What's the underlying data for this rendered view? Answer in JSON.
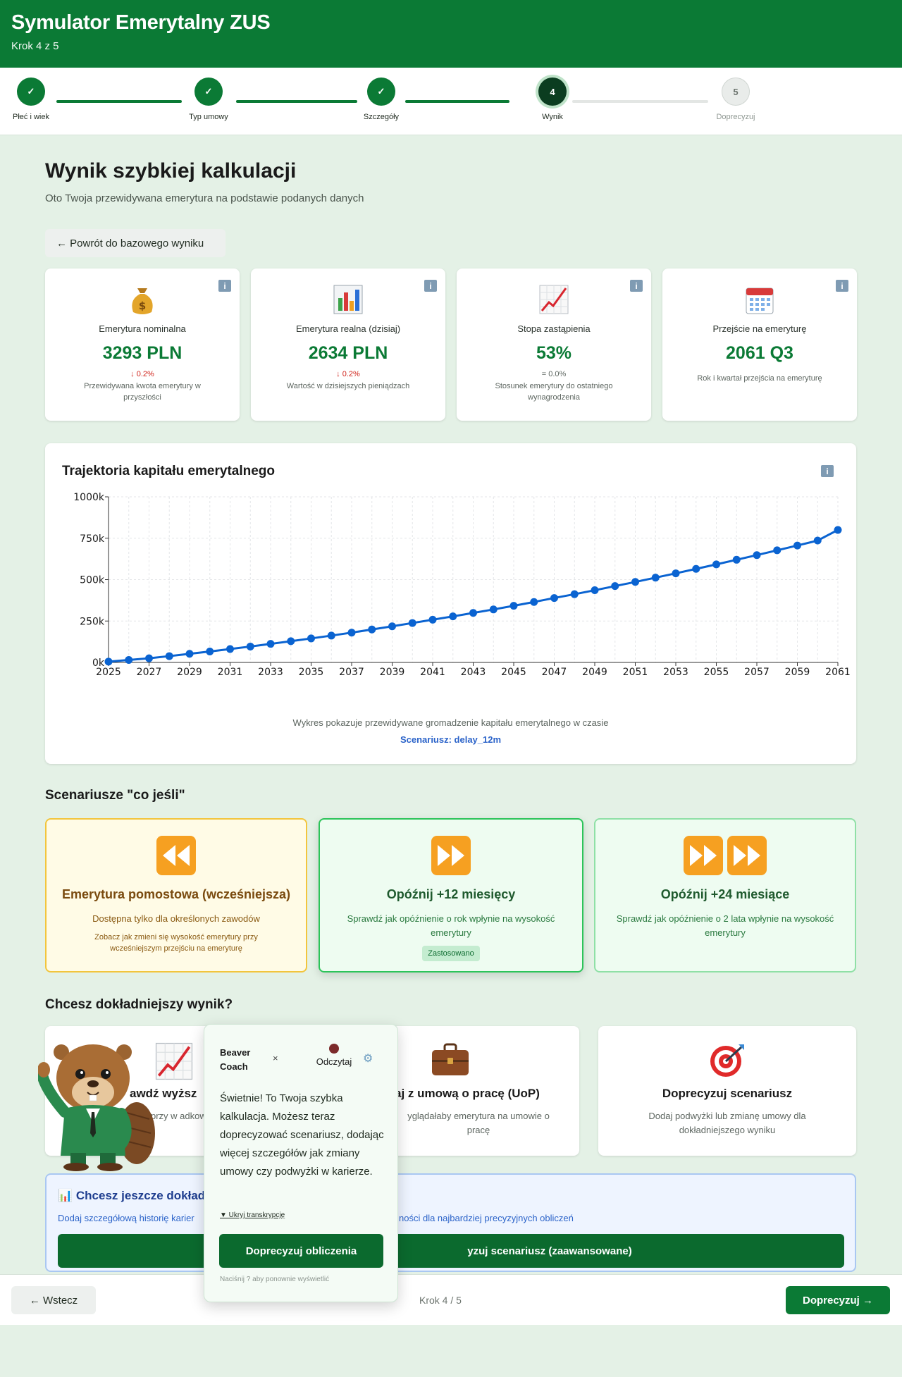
{
  "header": {
    "title": "Symulator Emerytalny ZUS",
    "step_text": "Krok 4 z 5"
  },
  "stepper": {
    "steps": [
      {
        "num": "✓",
        "label": "Płeć i wiek",
        "state": "done"
      },
      {
        "num": "✓",
        "label": "Typ umowy",
        "state": "done"
      },
      {
        "num": "✓",
        "label": "Szczegóły",
        "state": "done"
      },
      {
        "num": "4",
        "label": "Wynik",
        "state": "current"
      },
      {
        "num": "5",
        "label": "Doprecyzuj",
        "state": "todo"
      }
    ]
  },
  "main": {
    "title": "Wynik szybkiej kalkulacji",
    "subtitle": "Oto Twoja przewidywana emerytura na podstawie podanych danych",
    "back_button": "← Powrót do bazowego wyniku"
  },
  "metrics": [
    {
      "icon": "money-bag-icon",
      "label": "Emerytura nominalna",
      "value": "3293 PLN",
      "delta": "↓ 0.2%",
      "delta_color": "#d0241b",
      "desc": "Przewidywana kwota emerytury w przyszłości"
    },
    {
      "icon": "bar-chart-icon",
      "label": "Emerytura realna (dzisiaj)",
      "value": "2634 PLN",
      "delta": "↓ 0.2%",
      "delta_color": "#d0241b",
      "desc": "Wartość w dzisiejszych pieniądzach"
    },
    {
      "icon": "trend-chart-icon",
      "label": "Stopa zastąpienia",
      "value": "53%",
      "delta": "= 0.0%",
      "delta_color": "#5d6660",
      "desc": "Stosunek emerytury do ostatniego wynagrodzenia"
    },
    {
      "icon": "calendar-icon",
      "label": "Przejście na emeryturę",
      "value": "2061 Q3",
      "delta": "",
      "delta_color": "#5d6660",
      "desc": "Rok i kwartał przejścia na emeryturę"
    }
  ],
  "info_icon_glyph": "i",
  "chart": {
    "title": "Trajektoria kapitału emerytalnego",
    "caption": "Wykres pokazuje przewidywane gromadzenie kapitału emerytalnego w czasie",
    "scenario": "Scenariusz: delay_12m"
  },
  "chart_data": {
    "type": "line",
    "title": "Trajektoria kapitału emerytalnego",
    "x": [
      2025,
      2026,
      2027,
      2028,
      2029,
      2030,
      2031,
      2032,
      2033,
      2034,
      2035,
      2036,
      2037,
      2038,
      2039,
      2040,
      2041,
      2042,
      2043,
      2044,
      2045,
      2046,
      2047,
      2048,
      2049,
      2050,
      2051,
      2052,
      2053,
      2054,
      2055,
      2056,
      2057,
      2058,
      2059,
      2060,
      2061
    ],
    "series": [
      {
        "values": [
          5000,
          15000,
          25000,
          38000,
          52000,
          66000,
          81000,
          96000,
          112000,
          128000,
          145000,
          162000,
          180000,
          199000,
          218000,
          238000,
          258000,
          278000,
          299000,
          320000,
          342000,
          365000,
          389000,
          412000,
          436000,
          461000,
          486000,
          512000,
          538000,
          565000,
          592000,
          620000,
          648000,
          677000,
          706000,
          736000,
          800000
        ],
        "color": "#0a63d1"
      }
    ],
    "xticks": [
      2025,
      2027,
      2029,
      2031,
      2033,
      2035,
      2037,
      2039,
      2041,
      2043,
      2045,
      2047,
      2049,
      2051,
      2053,
      2055,
      2057,
      2059,
      2061
    ],
    "yticks": [
      "0k",
      "250k",
      "500k",
      "750k",
      "1000k"
    ],
    "ylim": [
      0,
      1000000
    ],
    "xlim": [
      2025,
      2061
    ],
    "grid": true
  },
  "scenarios_section": {
    "title": "Scenariusze \"co jeśli\""
  },
  "scenarios": [
    {
      "icon": "rewind-icon",
      "title": "Emerytura pomostowa (wcześniejsza)",
      "desc": "Dostępna tylko dla określonych zawodów",
      "extra": "Zobacz jak zmieni się wysokość emerytury przy wcześniejszym przejściu na emeryturę",
      "badge": ""
    },
    {
      "icon": "fast-forward-icon",
      "title": "Opóźnij +12 miesięcy",
      "desc": "Sprawdź jak opóźnienie o rok wpłynie na wysokość emerytury",
      "extra": "",
      "badge": "Zastosowano"
    },
    {
      "icon": "double-fast-forward-icon",
      "title": "Opóźnij +24 miesiące",
      "desc": "Sprawdź jak opóźnienie o 2 lata wpłynie na wysokość emerytury",
      "extra": "",
      "badge": ""
    }
  ],
  "accuracy_section": {
    "title": "Chcesz dokładniejszy wynik?"
  },
  "accuracy": [
    {
      "icon": "trend-chart-icon",
      "title": "awdź wyższ",
      "desc": "przy w adkowej"
    },
    {
      "icon": "briefcase-icon",
      "title": "aj z umową o pracę (UoP)",
      "desc": "yglądałaby emerytura na umowie o pracę"
    },
    {
      "icon": "target-icon",
      "title": "Doprecyzuj scenariusz",
      "desc": "Dodaj podwyżki lub zmianę umowy dla dokładniejszego wyniku"
    }
  ],
  "more": {
    "title": "📊 Chcesz jeszcze dokład",
    "desc": "Dodaj szczegółową historię karier",
    "desc_right": "ności dla najbardziej precyzyjnych obliczeń",
    "button": "yzuj scenariusz (zaawansowane)"
  },
  "coach": {
    "name_line1": "Beaver",
    "name_line2": "Coach",
    "close": "×",
    "read": "Odczytaj",
    "gear": "⚙",
    "message": "Świetnie! To Twoja szybka kalkulacja. Możesz teraz doprecyzować scenariusz, dodając więcej szczegółów jak zmiany umowy czy podwyżki w karierze.",
    "hide": "▼ Ukryj transkrypcję",
    "button": "Doprecyzuj obliczenia",
    "hint": "Naciśnij  ?  aby ponownie wyświetlić"
  },
  "footer": {
    "back": "← Wstecz",
    "step": "Krok 4 / 5",
    "next": "Doprecyzuj →"
  }
}
